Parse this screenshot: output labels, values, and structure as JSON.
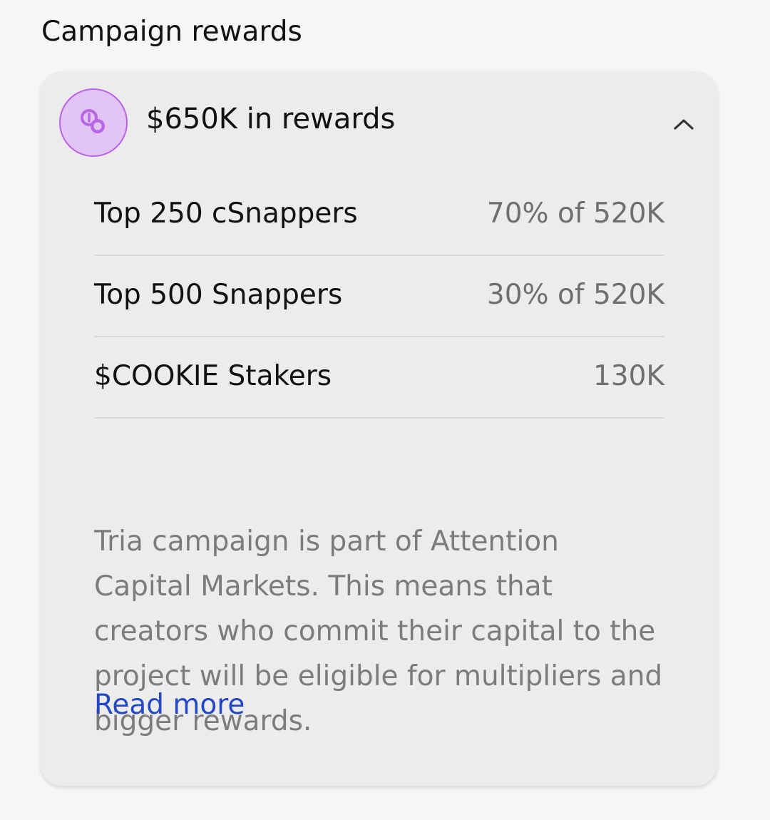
{
  "section": {
    "title": "Campaign rewards"
  },
  "card": {
    "icon": "coins-icon",
    "title": "$650K in rewards",
    "toggle_icon": "chevron-up-icon",
    "rows": [
      {
        "label": "Top 250 cSnappers",
        "value": "70% of 520K"
      },
      {
        "label": "Top 500 Snappers",
        "value": "30% of 520K"
      },
      {
        "label": "$COOKIE Stakers",
        "value": "130K"
      }
    ],
    "description": "Tria campaign is part of Attention Capital Markets. This means that creators who commit their capital to the project will be eligible for multipliers and bigger rewards.",
    "read_more": "Read more"
  },
  "colors": {
    "page_background": "#f6f6f6",
    "card_background": "#ececec",
    "badge_fill": "#e2c5f5",
    "badge_accent": "#b865e6",
    "link": "#2448c4",
    "muted_text": "#7c7c7c"
  }
}
